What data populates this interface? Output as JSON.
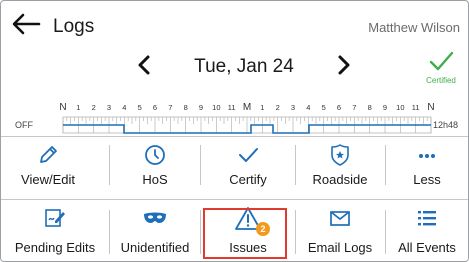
{
  "header": {
    "title": "Logs",
    "user_name": "Matthew Wilson"
  },
  "date_nav": {
    "date": "Tue, Jan 24",
    "status_text": "Certified"
  },
  "timeline": {
    "off_label": "OFF",
    "total_label": "12h48",
    "hour_labels": [
      "N",
      "1",
      "2",
      "3",
      "4",
      "5",
      "6",
      "7",
      "8",
      "9",
      "10",
      "11",
      "M",
      "1",
      "2",
      "3",
      "4",
      "5",
      "6",
      "7",
      "8",
      "9",
      "10",
      "11",
      "N"
    ]
  },
  "actions_row1": [
    {
      "label": "View/Edit",
      "icon": "pencil-icon"
    },
    {
      "label": "HoS",
      "icon": "clock-icon"
    },
    {
      "label": "Certify",
      "icon": "checkmark-icon"
    },
    {
      "label": "Roadside",
      "icon": "police-badge-icon"
    },
    {
      "label": "Less",
      "icon": "more-dots-icon"
    }
  ],
  "actions_row2": [
    {
      "label": "Pending Edits",
      "icon": "edit-document-icon"
    },
    {
      "label": "Unidentified",
      "icon": "mask-icon"
    },
    {
      "label": "Issues",
      "icon": "warning-icon",
      "badge": "2"
    },
    {
      "label": "Email Logs",
      "icon": "envelope-icon"
    },
    {
      "label": "All Events",
      "icon": "list-icon"
    }
  ],
  "colors": {
    "accent_blue": "#1f6fb8",
    "certified_green": "#3fae49",
    "badge_orange": "#f39a1e",
    "highlight_red": "#e03b2f"
  }
}
